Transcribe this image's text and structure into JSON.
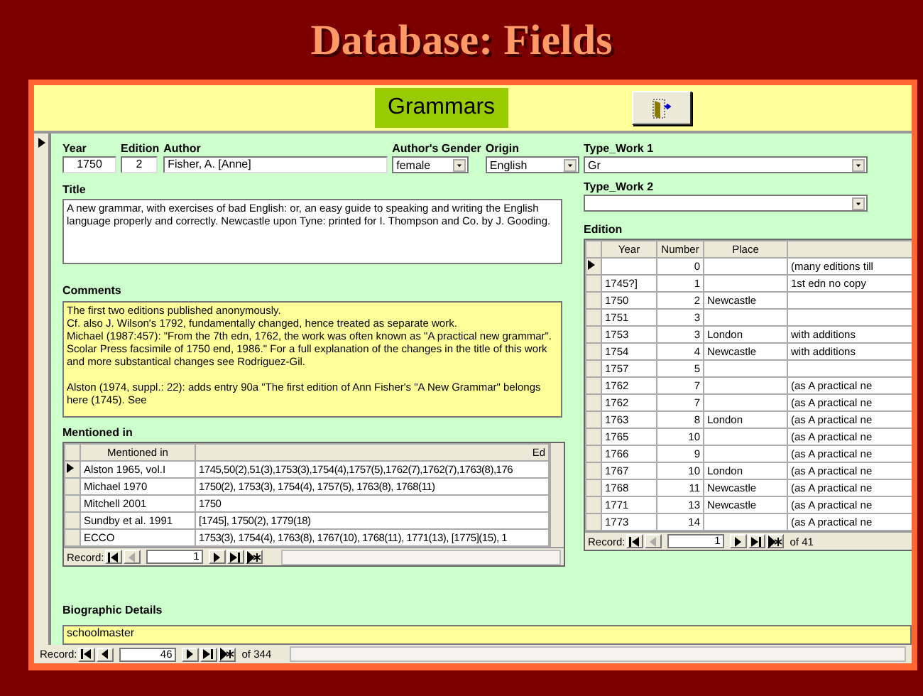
{
  "slide": {
    "title": "Database: Fields"
  },
  "header": {
    "title": "Grammars"
  },
  "fields": {
    "year": {
      "label": "Year",
      "value": "1750"
    },
    "edition": {
      "label": "Edition",
      "value": "2"
    },
    "author": {
      "label": "Author",
      "value": "Fisher, A. [Anne]"
    },
    "gender": {
      "label": "Author's Gender",
      "value": "female"
    },
    "origin": {
      "label": "Origin",
      "value": "English"
    },
    "type_work_1": {
      "label": "Type_Work 1",
      "value": "Gr"
    },
    "type_work_2": {
      "label": "Type_Work 2"
    },
    "title": {
      "label": "Title",
      "value": "A new grammar, with exercises of bad English: or, an easy guide to speaking and writing the English language properly and correctly. Newcastle upon Tyne: printed for I. Thompson and Co. by J. Gooding."
    },
    "comments": {
      "label": "Comments",
      "paragraphs": [
        "The first two editions published anonymously.\nCf. also J. Wilson's 1792, fundamentally changed, hence treated as separate work.\nMichael (1987:457): \"From the 7th edn, 1762, the work was often known as \"A practical new grammar\". Scolar Press facsimile of 1750 end, 1986.\" For a full explanation of the changes in the title of this work and more substantical changes see Rodriguez-Gil.",
        "Alston (1974, suppl.: 22): adds entry 90a \"The first edition of Ann Fisher's \"A New Grammar\" belongs here (1745). See"
      ]
    },
    "biographic": {
      "label": "Biographic Details",
      "value": "schoolmaster"
    }
  },
  "mentioned": {
    "label": "Mentioned in",
    "columns": [
      "Mentioned in",
      "Ed"
    ],
    "rows": [
      {
        "selected": true,
        "cells": [
          "Alston 1965, vol.I",
          "1745,50(2),51(3),1753(3),1754(4),1757(5),1762(7),1762(7),1763(8),176"
        ]
      },
      {
        "selected": false,
        "cells": [
          "Michael 1970",
          "1750(2), 1753(3), 1754(4), 1757(5), 1763(8), 1768(11)"
        ]
      },
      {
        "selected": false,
        "cells": [
          "Mitchell 2001",
          "1750"
        ]
      },
      {
        "selected": false,
        "cells": [
          "Sundby et al. 1991",
          "[1745], 1750(2), 1779(18)"
        ]
      },
      {
        "selected": false,
        "cells": [
          "ECCO",
          "1753(3), 1754(4), 1763(8), 1767(10), 1768(11), 1771(13), [1775](15), 1"
        ]
      }
    ],
    "nav": {
      "label": "Record:",
      "value": "1",
      "prev_enabled": false
    }
  },
  "edition": {
    "label": "Edition",
    "columns": [
      "Year",
      "Number",
      "Place"
    ],
    "rows": [
      {
        "selected": true,
        "cells": [
          "",
          "0",
          "",
          "(many editions till"
        ]
      },
      {
        "selected": false,
        "cells": [
          "1745?]",
          "1",
          "",
          "1st edn no copy"
        ]
      },
      {
        "selected": false,
        "cells": [
          "1750",
          "2",
          "Newcastle",
          ""
        ]
      },
      {
        "selected": false,
        "cells": [
          "1751",
          "3",
          "",
          ""
        ]
      },
      {
        "selected": false,
        "cells": [
          "1753",
          "3",
          "London",
          "with additions"
        ]
      },
      {
        "selected": false,
        "cells": [
          "1754",
          "4",
          "Newcastle",
          "with additions"
        ]
      },
      {
        "selected": false,
        "cells": [
          "1757",
          "5",
          "",
          ""
        ]
      },
      {
        "selected": false,
        "cells": [
          "1762",
          "7",
          "",
          "(as A practical ne"
        ]
      },
      {
        "selected": false,
        "cells": [
          "1762",
          "7",
          "",
          "(as A practical ne"
        ]
      },
      {
        "selected": false,
        "cells": [
          "1763",
          "8",
          "London",
          "(as A practical ne"
        ]
      },
      {
        "selected": false,
        "cells": [
          "1765",
          "10",
          "",
          "(as A practical ne"
        ]
      },
      {
        "selected": false,
        "cells": [
          "1766",
          "9",
          "",
          "(as A practical ne"
        ]
      },
      {
        "selected": false,
        "cells": [
          "1767",
          "10",
          "London",
          "(as A practical ne"
        ]
      },
      {
        "selected": false,
        "cells": [
          "1768",
          "11",
          "Newcastle",
          "(as A practical ne"
        ]
      },
      {
        "selected": false,
        "cells": [
          "1771",
          "13",
          "Newcastle",
          "(as A practical ne"
        ]
      },
      {
        "selected": false,
        "cells": [
          "1773",
          "14",
          "",
          "(as A practical ne"
        ]
      }
    ],
    "nav": {
      "label": "Record:",
      "value": "1",
      "prev_enabled": false,
      "total": "of 41"
    }
  },
  "record_nav": {
    "label": "Record:",
    "value": "46",
    "prev_enabled": true,
    "total": "of 344"
  }
}
